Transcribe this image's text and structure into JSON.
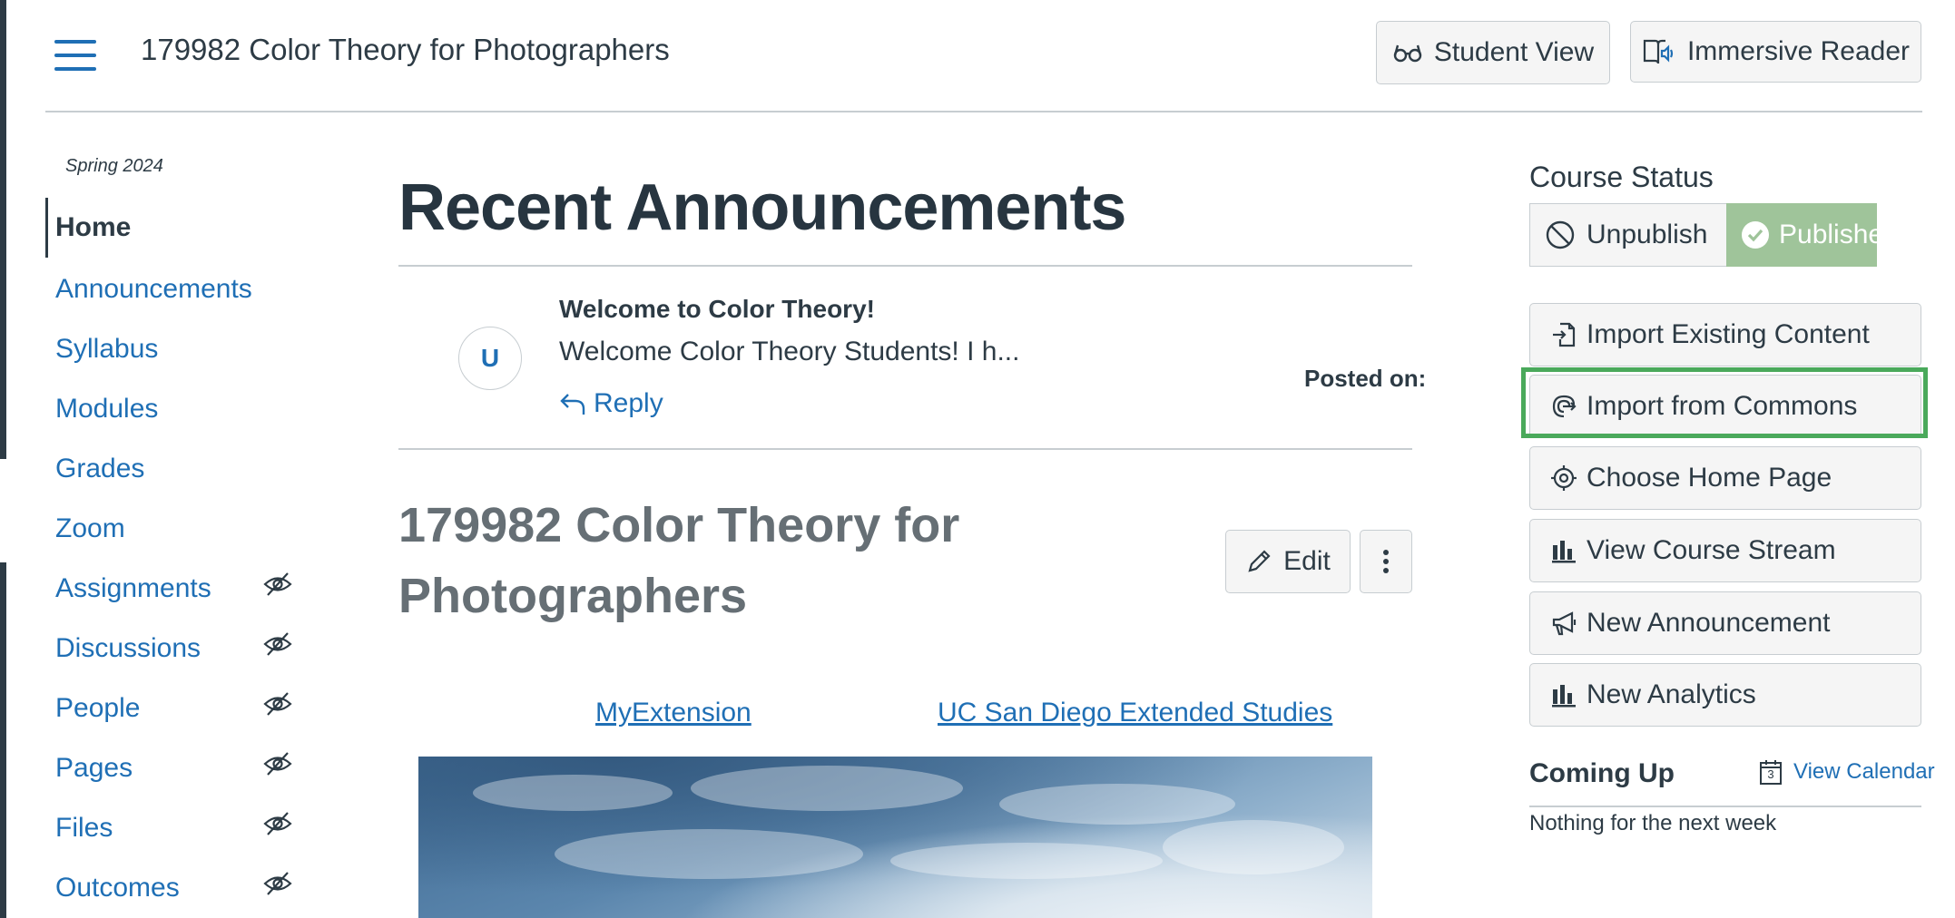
{
  "header": {
    "course_title": "179982 Color Theory for Photographers",
    "student_view_label": "Student View",
    "immersive_reader_label": "Immersive Reader"
  },
  "nav": {
    "term": "Spring 2024",
    "items": [
      {
        "label": "Home",
        "active": true,
        "hidden": false
      },
      {
        "label": "Announcements",
        "active": false,
        "hidden": false
      },
      {
        "label": "Syllabus",
        "active": false,
        "hidden": false
      },
      {
        "label": "Modules",
        "active": false,
        "hidden": false
      },
      {
        "label": "Grades",
        "active": false,
        "hidden": false
      },
      {
        "label": "Zoom",
        "active": false,
        "hidden": false
      },
      {
        "label": "Assignments",
        "active": false,
        "hidden": true
      },
      {
        "label": "Discussions",
        "active": false,
        "hidden": true
      },
      {
        "label": "People",
        "active": false,
        "hidden": true
      },
      {
        "label": "Pages",
        "active": false,
        "hidden": true
      },
      {
        "label": "Files",
        "active": false,
        "hidden": true
      },
      {
        "label": "Outcomes",
        "active": false,
        "hidden": true
      }
    ]
  },
  "main": {
    "recent_announcements_title": "Recent Announcements",
    "announcement": {
      "avatar_initial": "U",
      "title": "Welcome to Color Theory!",
      "snippet": "Welcome Color Theory Students!  I h...",
      "reply_label": "Reply",
      "posted_on_label": "Posted on:"
    },
    "page_title": "179982 Color Theory for Photographers",
    "edit_label": "Edit",
    "links": {
      "myextension": "MyExtension",
      "ucsd": "UC San Diego Extended Studies"
    }
  },
  "sidebar": {
    "course_status_title": "Course Status",
    "unpublish_label": "Unpublish",
    "published_label": "Published",
    "buttons": [
      {
        "label": "Import Existing Content",
        "icon": "import-icon"
      },
      {
        "label": "Import from Commons",
        "icon": "commons-icon"
      },
      {
        "label": "Choose Home Page",
        "icon": "target-icon"
      },
      {
        "label": "View Course Stream",
        "icon": "bar-chart-icon"
      },
      {
        "label": "New Announcement",
        "icon": "megaphone-icon"
      },
      {
        "label": "New Analytics",
        "icon": "bar-chart-icon"
      }
    ],
    "coming_up_title": "Coming Up",
    "view_calendar_label": "View Calendar",
    "calendar_day": "3",
    "nothing_label": "Nothing for the next week"
  },
  "colors": {
    "link": "#1f6fb5",
    "text": "#2d3b45",
    "published_bg": "#9fc49a",
    "highlight": "#4aa95b"
  }
}
